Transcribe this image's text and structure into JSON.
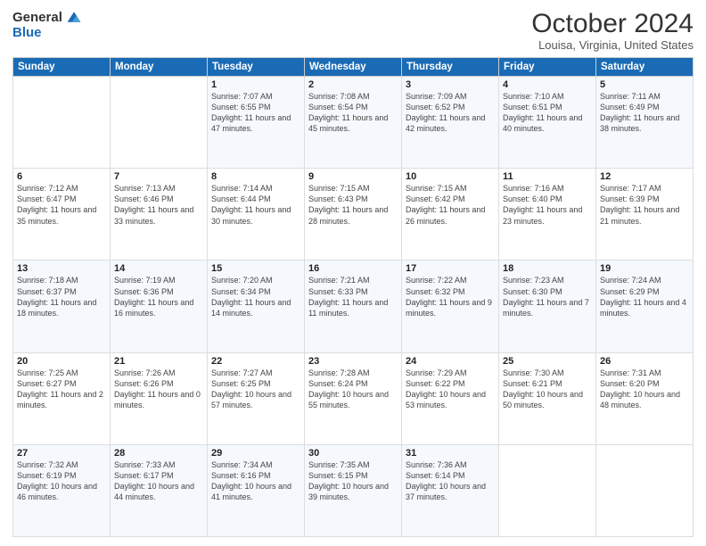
{
  "header": {
    "logo_general": "General",
    "logo_blue": "Blue",
    "month_title": "October 2024",
    "location": "Louisa, Virginia, United States"
  },
  "weekdays": [
    "Sunday",
    "Monday",
    "Tuesday",
    "Wednesday",
    "Thursday",
    "Friday",
    "Saturday"
  ],
  "weeks": [
    [
      {
        "day": "",
        "sunrise": "",
        "sunset": "",
        "daylight": ""
      },
      {
        "day": "",
        "sunrise": "",
        "sunset": "",
        "daylight": ""
      },
      {
        "day": "1",
        "sunrise": "Sunrise: 7:07 AM",
        "sunset": "Sunset: 6:55 PM",
        "daylight": "Daylight: 11 hours and 47 minutes."
      },
      {
        "day": "2",
        "sunrise": "Sunrise: 7:08 AM",
        "sunset": "Sunset: 6:54 PM",
        "daylight": "Daylight: 11 hours and 45 minutes."
      },
      {
        "day": "3",
        "sunrise": "Sunrise: 7:09 AM",
        "sunset": "Sunset: 6:52 PM",
        "daylight": "Daylight: 11 hours and 42 minutes."
      },
      {
        "day": "4",
        "sunrise": "Sunrise: 7:10 AM",
        "sunset": "Sunset: 6:51 PM",
        "daylight": "Daylight: 11 hours and 40 minutes."
      },
      {
        "day": "5",
        "sunrise": "Sunrise: 7:11 AM",
        "sunset": "Sunset: 6:49 PM",
        "daylight": "Daylight: 11 hours and 38 minutes."
      }
    ],
    [
      {
        "day": "6",
        "sunrise": "Sunrise: 7:12 AM",
        "sunset": "Sunset: 6:47 PM",
        "daylight": "Daylight: 11 hours and 35 minutes."
      },
      {
        "day": "7",
        "sunrise": "Sunrise: 7:13 AM",
        "sunset": "Sunset: 6:46 PM",
        "daylight": "Daylight: 11 hours and 33 minutes."
      },
      {
        "day": "8",
        "sunrise": "Sunrise: 7:14 AM",
        "sunset": "Sunset: 6:44 PM",
        "daylight": "Daylight: 11 hours and 30 minutes."
      },
      {
        "day": "9",
        "sunrise": "Sunrise: 7:15 AM",
        "sunset": "Sunset: 6:43 PM",
        "daylight": "Daylight: 11 hours and 28 minutes."
      },
      {
        "day": "10",
        "sunrise": "Sunrise: 7:15 AM",
        "sunset": "Sunset: 6:42 PM",
        "daylight": "Daylight: 11 hours and 26 minutes."
      },
      {
        "day": "11",
        "sunrise": "Sunrise: 7:16 AM",
        "sunset": "Sunset: 6:40 PM",
        "daylight": "Daylight: 11 hours and 23 minutes."
      },
      {
        "day": "12",
        "sunrise": "Sunrise: 7:17 AM",
        "sunset": "Sunset: 6:39 PM",
        "daylight": "Daylight: 11 hours and 21 minutes."
      }
    ],
    [
      {
        "day": "13",
        "sunrise": "Sunrise: 7:18 AM",
        "sunset": "Sunset: 6:37 PM",
        "daylight": "Daylight: 11 hours and 18 minutes."
      },
      {
        "day": "14",
        "sunrise": "Sunrise: 7:19 AM",
        "sunset": "Sunset: 6:36 PM",
        "daylight": "Daylight: 11 hours and 16 minutes."
      },
      {
        "day": "15",
        "sunrise": "Sunrise: 7:20 AM",
        "sunset": "Sunset: 6:34 PM",
        "daylight": "Daylight: 11 hours and 14 minutes."
      },
      {
        "day": "16",
        "sunrise": "Sunrise: 7:21 AM",
        "sunset": "Sunset: 6:33 PM",
        "daylight": "Daylight: 11 hours and 11 minutes."
      },
      {
        "day": "17",
        "sunrise": "Sunrise: 7:22 AM",
        "sunset": "Sunset: 6:32 PM",
        "daylight": "Daylight: 11 hours and 9 minutes."
      },
      {
        "day": "18",
        "sunrise": "Sunrise: 7:23 AM",
        "sunset": "Sunset: 6:30 PM",
        "daylight": "Daylight: 11 hours and 7 minutes."
      },
      {
        "day": "19",
        "sunrise": "Sunrise: 7:24 AM",
        "sunset": "Sunset: 6:29 PM",
        "daylight": "Daylight: 11 hours and 4 minutes."
      }
    ],
    [
      {
        "day": "20",
        "sunrise": "Sunrise: 7:25 AM",
        "sunset": "Sunset: 6:27 PM",
        "daylight": "Daylight: 11 hours and 2 minutes."
      },
      {
        "day": "21",
        "sunrise": "Sunrise: 7:26 AM",
        "sunset": "Sunset: 6:26 PM",
        "daylight": "Daylight: 11 hours and 0 minutes."
      },
      {
        "day": "22",
        "sunrise": "Sunrise: 7:27 AM",
        "sunset": "Sunset: 6:25 PM",
        "daylight": "Daylight: 10 hours and 57 minutes."
      },
      {
        "day": "23",
        "sunrise": "Sunrise: 7:28 AM",
        "sunset": "Sunset: 6:24 PM",
        "daylight": "Daylight: 10 hours and 55 minutes."
      },
      {
        "day": "24",
        "sunrise": "Sunrise: 7:29 AM",
        "sunset": "Sunset: 6:22 PM",
        "daylight": "Daylight: 10 hours and 53 minutes."
      },
      {
        "day": "25",
        "sunrise": "Sunrise: 7:30 AM",
        "sunset": "Sunset: 6:21 PM",
        "daylight": "Daylight: 10 hours and 50 minutes."
      },
      {
        "day": "26",
        "sunrise": "Sunrise: 7:31 AM",
        "sunset": "Sunset: 6:20 PM",
        "daylight": "Daylight: 10 hours and 48 minutes."
      }
    ],
    [
      {
        "day": "27",
        "sunrise": "Sunrise: 7:32 AM",
        "sunset": "Sunset: 6:19 PM",
        "daylight": "Daylight: 10 hours and 46 minutes."
      },
      {
        "day": "28",
        "sunrise": "Sunrise: 7:33 AM",
        "sunset": "Sunset: 6:17 PM",
        "daylight": "Daylight: 10 hours and 44 minutes."
      },
      {
        "day": "29",
        "sunrise": "Sunrise: 7:34 AM",
        "sunset": "Sunset: 6:16 PM",
        "daylight": "Daylight: 10 hours and 41 minutes."
      },
      {
        "day": "30",
        "sunrise": "Sunrise: 7:35 AM",
        "sunset": "Sunset: 6:15 PM",
        "daylight": "Daylight: 10 hours and 39 minutes."
      },
      {
        "day": "31",
        "sunrise": "Sunrise: 7:36 AM",
        "sunset": "Sunset: 6:14 PM",
        "daylight": "Daylight: 10 hours and 37 minutes."
      },
      {
        "day": "",
        "sunrise": "",
        "sunset": "",
        "daylight": ""
      },
      {
        "day": "",
        "sunrise": "",
        "sunset": "",
        "daylight": ""
      }
    ]
  ]
}
